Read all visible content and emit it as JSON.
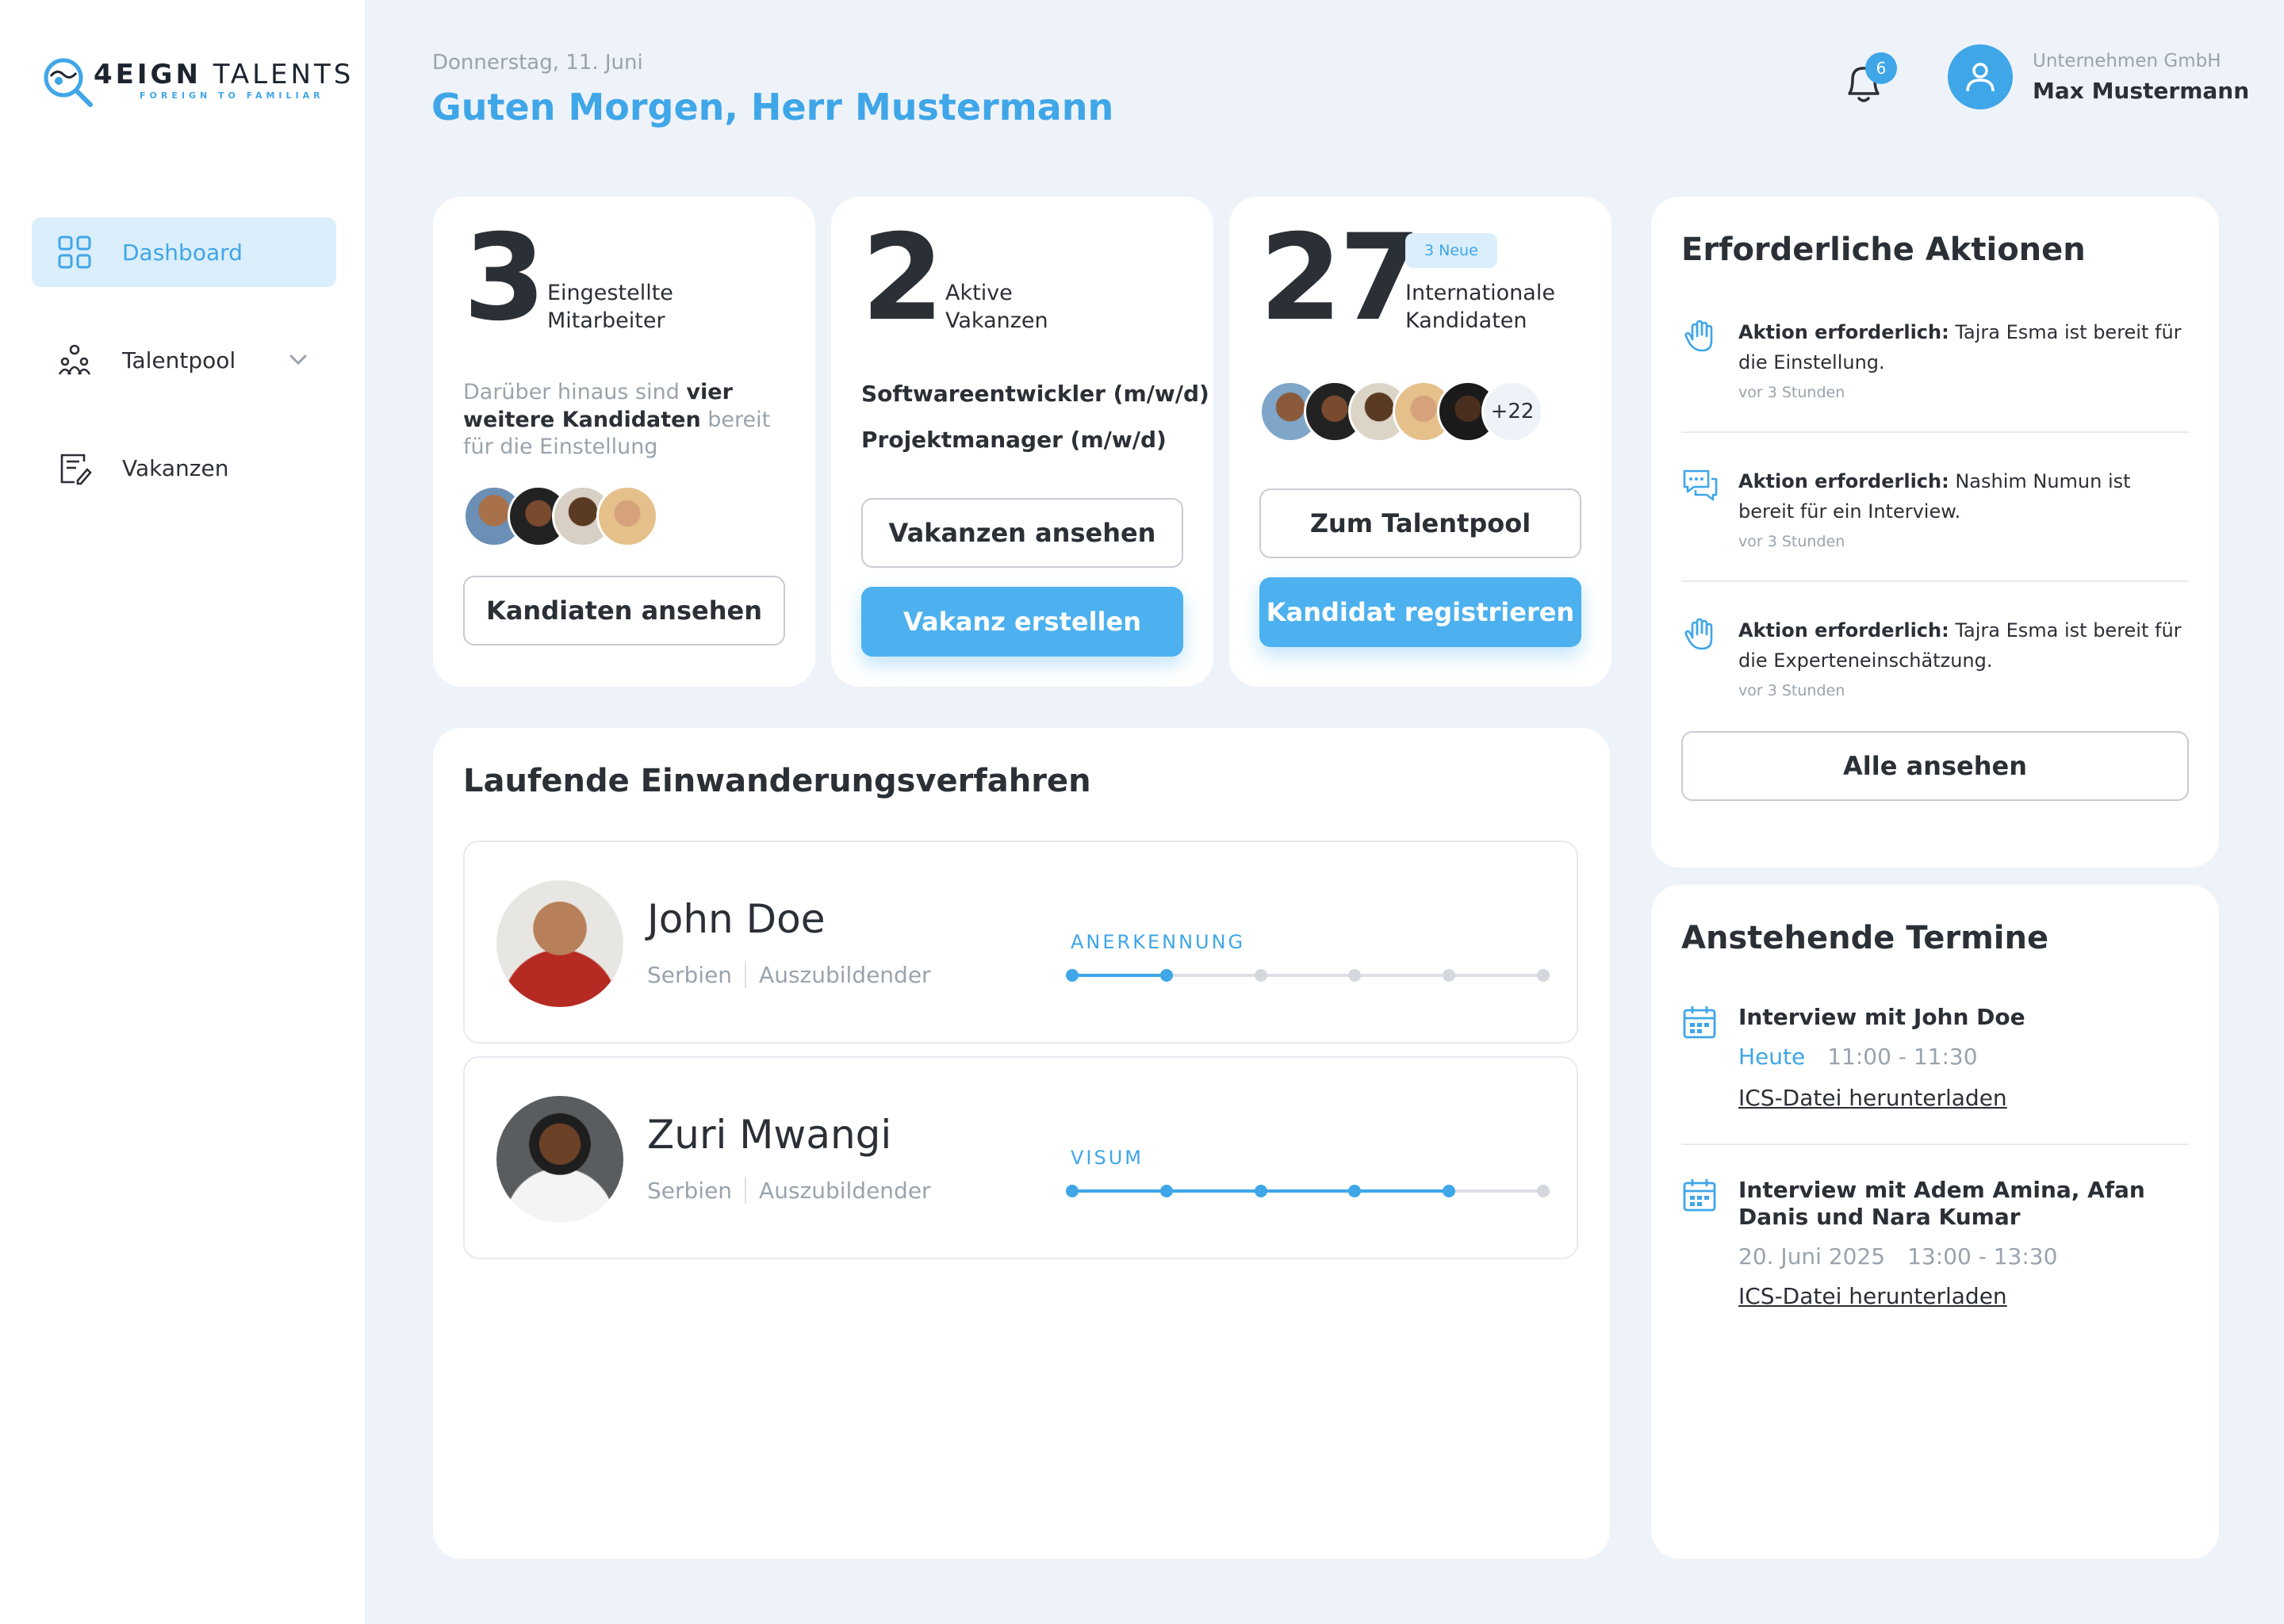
{
  "brand": {
    "name_bold": "4EIGN",
    "name_rest": "TALENTS",
    "tagline": "FOREIGN TO FAMILIAR",
    "accent": "#3fa6e8"
  },
  "sidebar": {
    "items": [
      {
        "label": "Dashboard",
        "icon": "grid-icon",
        "active": true
      },
      {
        "label": "Talentpool",
        "icon": "people-network-icon",
        "active": false,
        "has_chevron": true
      },
      {
        "label": "Vakanzen",
        "icon": "document-edit-icon",
        "active": false
      }
    ]
  },
  "header": {
    "date": "Donnerstag, 11. Juni",
    "greeting": "Guten Morgen, Herr Mustermann",
    "notifications": "6",
    "company": "Unternehmen GmbH",
    "user": "Max Mustermann"
  },
  "stats": {
    "hired": {
      "number": "3",
      "label_l1": "Eingestellte",
      "label_l2": "Mitarbeiter",
      "desc_pre": "Darüber hinaus sind ",
      "desc_bold": "vier weitere Kandidaten",
      "desc_post": " bereit für die Einstellung",
      "button": "Kandiaten ansehen"
    },
    "vacancies": {
      "number": "2",
      "label_l1": "Aktive",
      "label_l2": "Vakanzen",
      "items": [
        "Softwareentwickler (m/w/d)",
        "Projektmanager (m/w/d)"
      ],
      "button_secondary": "Vakanzen ansehen",
      "button_primary": "Vakanz erstellen"
    },
    "candidates": {
      "number": "27",
      "chip": "3 Neue",
      "label_l1": "Internationale",
      "label_l2": "Kandidaten",
      "more": "+22",
      "button_secondary": "Zum Talentpool",
      "button_primary": "Kandidat registrieren"
    }
  },
  "processes": {
    "title": "Laufende Einwanderungsverfahren",
    "rows": [
      {
        "name": "John Doe",
        "country": "Serbien",
        "role": "Auszubildender",
        "stage": "ANERKENNUNG",
        "progress": 0.2,
        "steps": 6
      },
      {
        "name": "Zuri Mwangi",
        "country": "Serbien",
        "role": "Auszubildender",
        "stage": "VISUM",
        "progress": 0.8,
        "steps": 6
      }
    ]
  },
  "actions": {
    "title": "Erforderliche Aktionen",
    "items": [
      {
        "icon": "hand-icon",
        "bold": "Aktion erforderlich:",
        "text": " Tajra Esma ist bereit für die Einstellung.",
        "time": "vor 3 Stunden"
      },
      {
        "icon": "chat-icon",
        "bold": "Aktion erforderlich:",
        "text": " Nashim Numun ist bereit für ein Interview.",
        "time": "vor 3 Stunden"
      },
      {
        "icon": "hand-icon",
        "bold": "Aktion erforderlich:",
        "text": " Tajra Esma ist bereit für die Experteneinschätzung.",
        "time": "vor 3 Stunden"
      }
    ],
    "button": "Alle ansehen"
  },
  "events": {
    "title": "Anstehende Termine",
    "items": [
      {
        "title": "Interview mit John Doe",
        "date": "Heute",
        "time": "11:00 - 11:30",
        "link": "ICS-Datei herunterladen"
      },
      {
        "title": "Interview mit Adem Amina, Afan Danis und Nara Kumar",
        "date": "20. Juni 2025",
        "time": "13:00 - 13:30",
        "link": "ICS-Datei herunterladen"
      }
    ]
  }
}
